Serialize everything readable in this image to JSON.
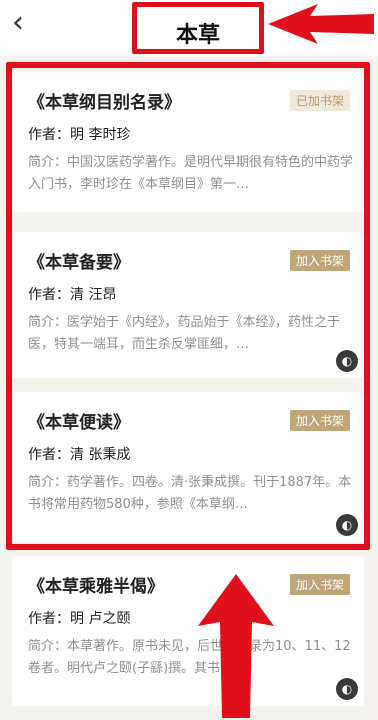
{
  "header": {
    "back_icon": "chevron-left-icon",
    "title": "本草"
  },
  "colors": {
    "annotation_red": "#e0101c",
    "badge_gold": "#bfa679"
  },
  "books": [
    {
      "title": "《本草纲目别名录》",
      "badge": "已加书架",
      "author": "作者：明 李时珍",
      "desc": "简介：中国汉医药学著作。是明代早期很有特色的中药学入门书，李时珍在《本草纲目》第一…"
    },
    {
      "title": "《本草备要》",
      "badge": "加入书架",
      "author": "作者：清 汪昂",
      "desc": "简介：医学始于《内经》，药品始于《本经》，药性之于医，特其一端耳，而生杀反掌匪细，…"
    },
    {
      "title": "《本草便读》",
      "badge": "加入书架",
      "author": "作者：清 张秉成",
      "desc": "简介：药学著作。四卷。清·张秉成撰。刊于1887年。本书将常用药物580种，参照《本草纲…"
    },
    {
      "title": "《本草乘雅半偈》",
      "badge": "加入书架",
      "author": "作者：明 卢之颐",
      "desc": "简介：本草著作。原书未见，后世存著录为10、11、12卷者。明代卢之颐(子繇)撰。其书初…"
    }
  ]
}
